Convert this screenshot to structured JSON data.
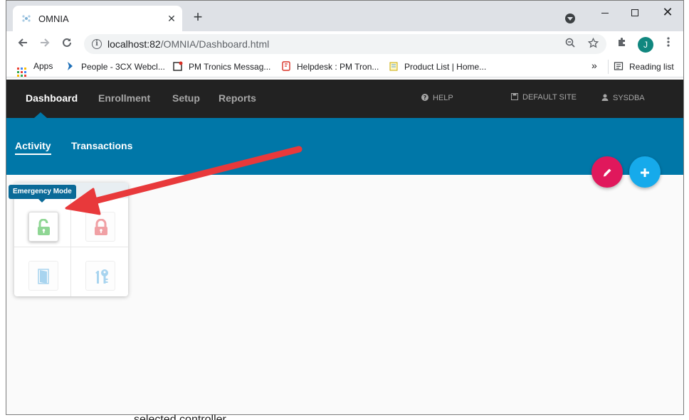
{
  "browser": {
    "tab_title": "OMNIA",
    "tab_close": "✕",
    "new_tab": "+",
    "url_host": "localhost:82",
    "url_path": "/OMNIA/Dashboard.html",
    "avatar_letter": "J",
    "window_close": "✕"
  },
  "bookmarks": {
    "apps_label": "Apps",
    "items": [
      "People - 3CX Webcl...",
      "PM Tronics Messag...",
      "Helpdesk : PM Tron...",
      "Product List | Home..."
    ],
    "overflow": "»",
    "reading_list": "Reading list"
  },
  "header": {
    "nav": [
      "Dashboard",
      "Enrollment",
      "Setup",
      "Reports"
    ],
    "active_nav": "Dashboard",
    "help": "HELP",
    "site": "DEFAULT SITE",
    "user": "SYSDBA"
  },
  "subnav": {
    "tabs": [
      "Activity",
      "Transactions"
    ],
    "active_tab": "Activity"
  },
  "fabs": {
    "edit_icon": "pencil-icon",
    "add_icon": "plus-icon",
    "edit_color": "#e0185c",
    "add_color": "#16aaeb"
  },
  "panel": {
    "tooltip": "Emergency Mode",
    "tiles": [
      "unlocked-padlock-icon",
      "locked-padlock-icon",
      "door-icon",
      "key-icon"
    ]
  },
  "annotation": {
    "arrow_color": "#e8393b"
  },
  "background_text": "selected controller",
  "colors": {
    "header_bg": "#222222",
    "subbar_bg": "#0077a8"
  }
}
